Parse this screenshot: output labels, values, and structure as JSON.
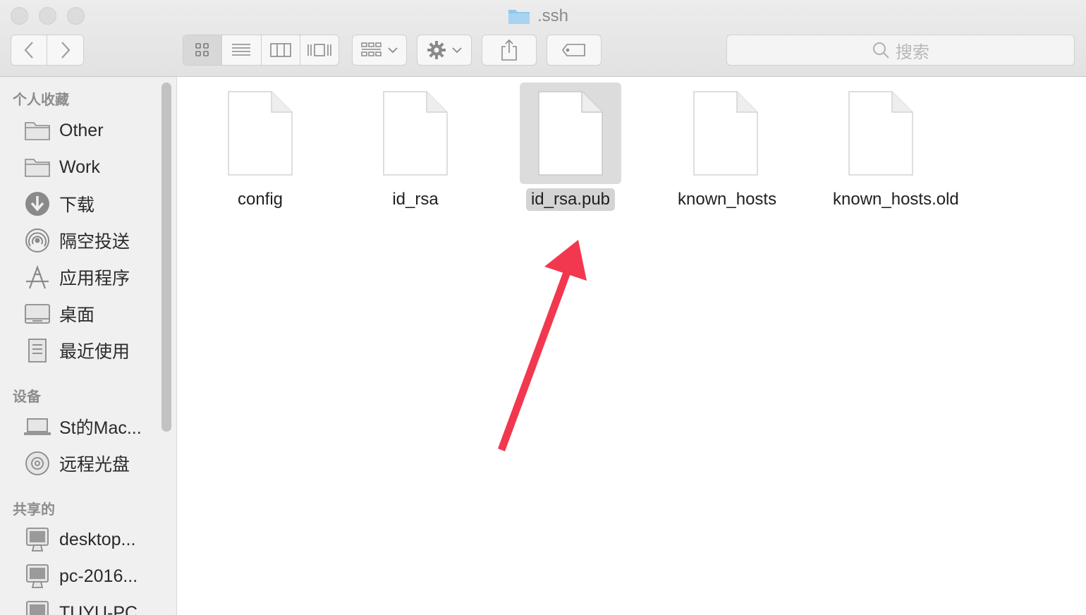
{
  "window": {
    "title": ".ssh"
  },
  "toolbar": {
    "back_icon": "chevron-left-icon",
    "forward_icon": "chevron-right-icon",
    "views": [
      "icon-view",
      "list-view",
      "column-view",
      "cover-flow-view"
    ],
    "active_view": "icon-view",
    "search_placeholder": "搜索"
  },
  "sidebar": {
    "sections": {
      "favorites": "个人收藏",
      "devices": "设备",
      "shared": "共享的"
    },
    "favorites": [
      {
        "label": "Other",
        "icon": "folder-icon"
      },
      {
        "label": "Work",
        "icon": "folder-icon"
      },
      {
        "label": "下载",
        "icon": "download-icon"
      },
      {
        "label": "隔空投送",
        "icon": "airdrop-icon"
      },
      {
        "label": "应用程序",
        "icon": "applications-icon"
      },
      {
        "label": "桌面",
        "icon": "desktop-icon"
      },
      {
        "label": "最近使用",
        "icon": "recents-icon"
      }
    ],
    "devices": [
      {
        "label": "St的Mac...",
        "icon": "laptop-icon"
      },
      {
        "label": "远程光盘",
        "icon": "disc-icon"
      }
    ],
    "shared": [
      {
        "label": "desktop...",
        "icon": "monitor-icon"
      },
      {
        "label": "pc-2016...",
        "icon": "monitor-icon"
      },
      {
        "label": "TUYU-PC",
        "icon": "monitor-icon"
      }
    ]
  },
  "files": [
    {
      "name": "config",
      "selected": false
    },
    {
      "name": "id_rsa",
      "selected": false
    },
    {
      "name": "id_rsa.pub",
      "selected": true
    },
    {
      "name": "known_hosts",
      "selected": false
    },
    {
      "name": "known_hosts.old",
      "selected": false
    }
  ],
  "annotation": {
    "type": "arrow",
    "color": "#f2384f"
  },
  "colors": {
    "folder_blue": "#8fc8ee",
    "selection_gray": "#d4d4d4"
  }
}
